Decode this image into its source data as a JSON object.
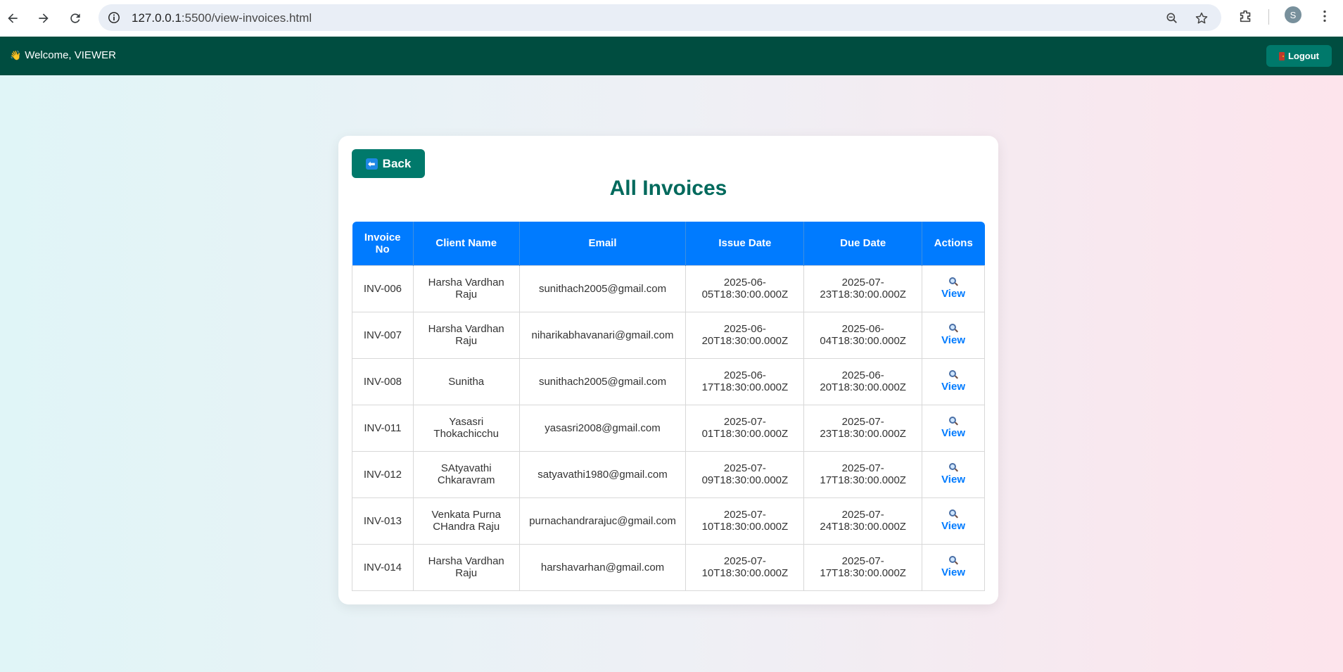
{
  "browser": {
    "url_host": "127.0.0.1",
    "url_rest": ":5500/view-invoices.html",
    "profile_initial": "S"
  },
  "header": {
    "welcome_text": "Welcome, VIEWER",
    "logout_label": "Logout"
  },
  "page": {
    "back_label": "Back",
    "title": "All Invoices"
  },
  "table": {
    "columns": [
      "Invoice No",
      "Client Name",
      "Email",
      "Issue Date",
      "Due Date",
      "Actions"
    ],
    "action_label": "View",
    "rows": [
      {
        "invoice_no": "INV-006",
        "client": "Harsha Vardhan Raju",
        "email": "sunithach2005@gmail.com",
        "issue": "2025-06-05T18:30:00.000Z",
        "due": "2025-07-23T18:30:00.000Z"
      },
      {
        "invoice_no": "INV-007",
        "client": "Harsha Vardhan Raju",
        "email": "niharikabhavanari@gmail.com",
        "issue": "2025-06-20T18:30:00.000Z",
        "due": "2025-06-04T18:30:00.000Z"
      },
      {
        "invoice_no": "INV-008",
        "client": "Sunitha",
        "email": "sunithach2005@gmail.com",
        "issue": "2025-06-17T18:30:00.000Z",
        "due": "2025-06-20T18:30:00.000Z"
      },
      {
        "invoice_no": "INV-011",
        "client": "Yasasri Thokachicchu",
        "email": "yasasri2008@gmail.com",
        "issue": "2025-07-01T18:30:00.000Z",
        "due": "2025-07-23T18:30:00.000Z"
      },
      {
        "invoice_no": "INV-012",
        "client": "SAtyavathi Chkaravram",
        "email": "satyavathi1980@gmail.com",
        "issue": "2025-07-09T18:30:00.000Z",
        "due": "2025-07-17T18:30:00.000Z"
      },
      {
        "invoice_no": "INV-013",
        "client": "Venkata Purna CHandra Raju",
        "email": "purnachandrarajuc@gmail.com",
        "issue": "2025-07-10T18:30:00.000Z",
        "due": "2025-07-24T18:30:00.000Z"
      },
      {
        "invoice_no": "INV-014",
        "client": "Harsha Vardhan Raju",
        "email": "harshavarhan@gmail.com",
        "issue": "2025-07-10T18:30:00.000Z",
        "due": "2025-07-17T18:30:00.000Z"
      }
    ]
  }
}
